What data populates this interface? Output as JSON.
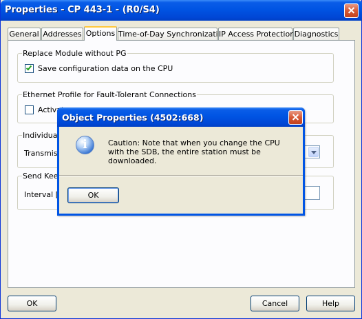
{
  "window": {
    "title": "Properties - CP 443-1 - (R0/S4)"
  },
  "tabs": [
    {
      "label": "General"
    },
    {
      "label": "Addresses"
    },
    {
      "label": "Options"
    },
    {
      "label": "Time-of-Day Synchronization"
    },
    {
      "label": "IP Access Protection"
    },
    {
      "label": "Diagnostics"
    }
  ],
  "options": {
    "replace_group": {
      "label": "Replace Module without PG",
      "checkbox_label": "Save configuration data on the CPU",
      "checked": true
    },
    "ethernet_group": {
      "label": "Ethernet Profile for Fault-Tolerant Connections",
      "checkbox_label": "Activat",
      "checked": false
    },
    "individual_group": {
      "label": "Individual",
      "field_label": "Transmissi"
    },
    "keepalive_group": {
      "label": "Send Keep",
      "field_label": "Interval [se"
    }
  },
  "footer": {
    "ok": "OK",
    "cancel": "Cancel",
    "help": "Help"
  },
  "dialog": {
    "title": "Object Properties  (4502:668)",
    "icon": "info-icon",
    "message": "Caution: Note that when you change the CPU with the SDB, the entire station must be downloaded.",
    "ok": "OK"
  }
}
